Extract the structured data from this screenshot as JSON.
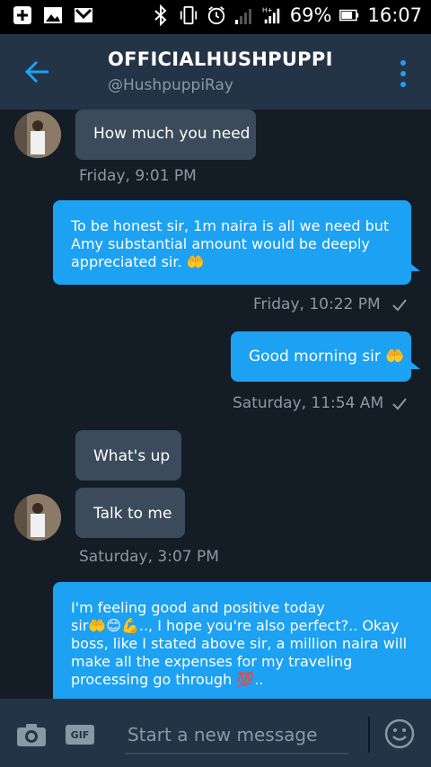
{
  "status_bar": {
    "battery": "69%",
    "time": "16:07"
  },
  "header": {
    "title": "OFFICIALHUSHPUPPI",
    "handle": "@HushpuppiRay"
  },
  "messages": [
    {
      "direction": "in",
      "text": "How much you need",
      "meta": "Friday, 9:01 PM"
    },
    {
      "direction": "out",
      "lines": [
        "To be honest sir, 1m naira is all we need but",
        "Amy substantial amount would be deeply",
        "appreciated sir. 🤲"
      ],
      "meta": "Friday, 10:22 PM"
    },
    {
      "direction": "out",
      "text": "Good morning sir 🤲",
      "meta": "Saturday, 11:54 AM"
    },
    {
      "direction": "in",
      "text": "What's up"
    },
    {
      "direction": "in",
      "text": "Talk to me",
      "meta": "Saturday, 3:07 PM"
    },
    {
      "direction": "out",
      "lines": [
        "I'm feeling good and  positive today",
        "sir🤲😊💪.., I hope you're also perfect?.. Okay",
        "boss, like I stated above sir, a million naira will",
        "make all the expenses for my traveling",
        "processing go through 💯.."
      ]
    }
  ],
  "composer": {
    "gif_label": "GIF",
    "placeholder": "Start a new message"
  }
}
